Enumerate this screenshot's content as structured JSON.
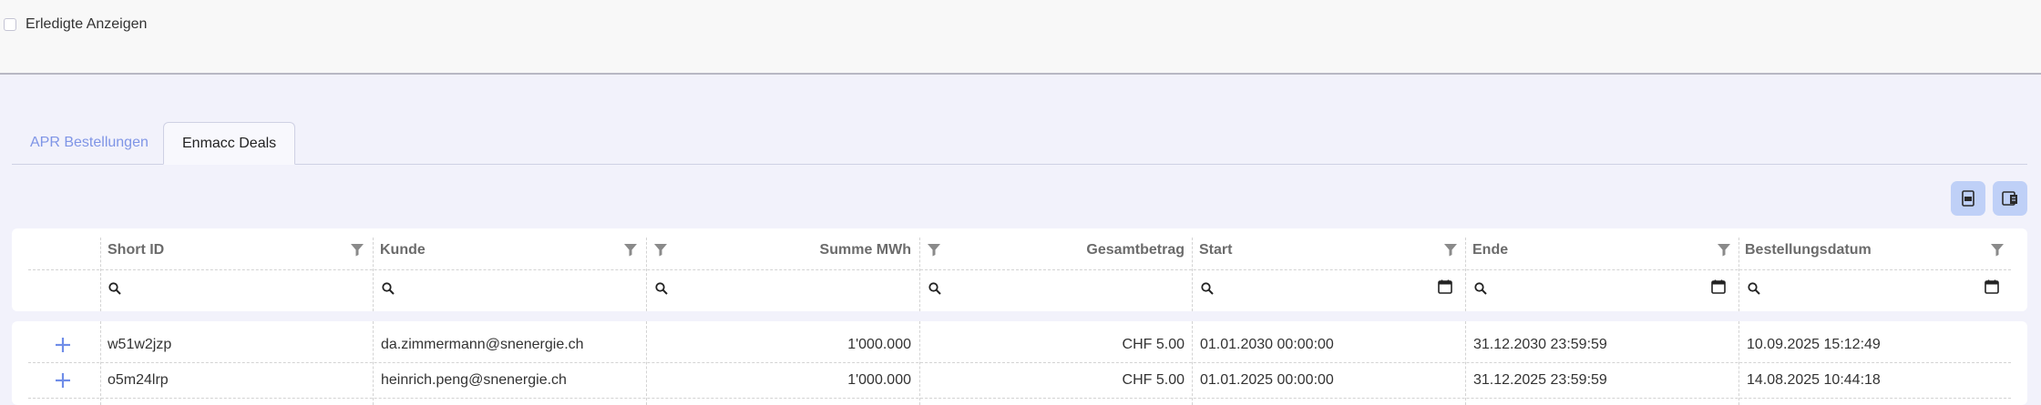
{
  "topbar": {
    "show_done_label": "Erledigte Anzeigen"
  },
  "tabs": [
    {
      "label": "APR Bestellungen",
      "active": false
    },
    {
      "label": "Enmacc Deals",
      "active": true
    }
  ],
  "toolbar": {
    "csv_icon": "file-csv-icon",
    "export_icon": "export-excel-icon"
  },
  "table": {
    "columns": [
      {
        "key": "short_id",
        "label": "Short ID"
      },
      {
        "key": "kunde",
        "label": "Kunde"
      },
      {
        "key": "summe_mwh",
        "label": "Summe MWh"
      },
      {
        "key": "gesamtbetrag",
        "label": "Gesamtbetrag"
      },
      {
        "key": "start",
        "label": "Start"
      },
      {
        "key": "ende",
        "label": "Ende"
      },
      {
        "key": "bestellungsdatum",
        "label": "Bestellungsdatum"
      }
    ],
    "rows": [
      {
        "short_id": "w51w2jzp",
        "kunde": "da.zimmermann@snenergie.ch",
        "summe_mwh": "1'000.000",
        "gesamtbetrag": "CHF 5.00",
        "start": "01.01.2030 00:00:00",
        "ende": "31.12.2030 23:59:59",
        "bestellungsdatum": "10.09.2025 15:12:49"
      },
      {
        "short_id": "o5m24lrp",
        "kunde": "heinrich.peng@snenergie.ch",
        "summe_mwh": "1'000.000",
        "gesamtbetrag": "CHF 5.00",
        "start": "01.01.2025 00:00:00",
        "ende": "31.12.2025 23:59:59",
        "bestellungsdatum": "14.08.2025 10:44:18"
      }
    ]
  }
}
